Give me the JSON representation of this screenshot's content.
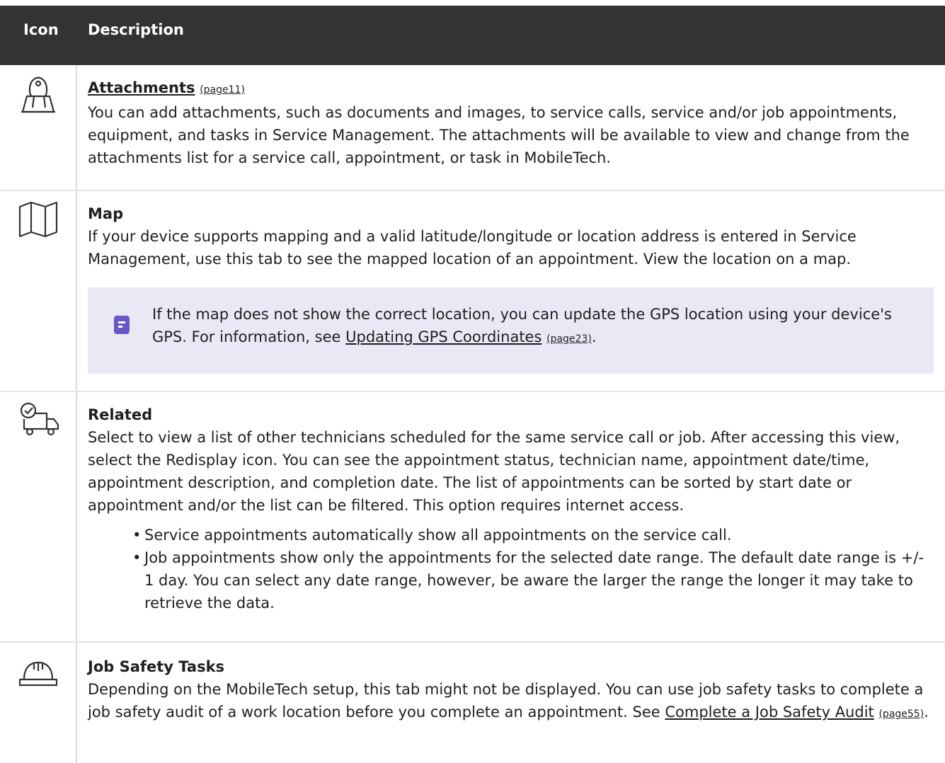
{
  "header": {
    "icon_col": "Icon",
    "desc_col": "Description"
  },
  "rows": {
    "attachments": {
      "icon": "binder-clip-icon",
      "title": "Attachments",
      "page_ref": "(page11)",
      "body": "You can add attachments, such as documents and images, to service calls, service and/or job appointments, equipment, and tasks in Service Management. The attachments will be available to view and change from the attachments list for a service call, appointment, or task in MobileTech."
    },
    "map": {
      "icon": "folded-map-icon",
      "title": "Map",
      "body": "If your device supports mapping and a valid latitude/longitude or location address is entered in Service Management, use this tab to see the mapped location of an appointment. View the location on a map.",
      "note": {
        "icon": "note-icon",
        "text": "If the map does not show the correct location, you can update the GPS location using your device's GPS. For information, see ",
        "link_text": "Updating GPS Coordinates",
        "page_ref": "(page23)",
        "suffix": "."
      }
    },
    "related": {
      "icon": "truck-check-icon",
      "title": "Related",
      "body": "Select to view a list of other technicians scheduled for the same service call or job. After accessing this view, select the Redisplay icon. You can see the appointment status, technician name, appointment date/time, appointment description, and completion date. The list of appointments can be sorted by start date or appointment and/or the list can be filtered. This option requires internet access.",
      "bullets": [
        "Service appointments automatically show all appointments on the service call.",
        "Job appointments show only the appointments for the selected date range. The default date range is +/- 1 day. You can select any date range, however, be aware the larger the range the longer it may take to retrieve the data."
      ]
    },
    "safety": {
      "icon": "hard-hat-icon",
      "title": "Job Safety Tasks",
      "body": "Depending on the MobileTech setup, this tab might not be displayed. You can use job safety tasks to complete a job safety audit of a work location before you complete an appointment. See ",
      "link_text": "Complete a Job Safety Audit",
      "page_ref": "(page55)",
      "suffix": "."
    }
  },
  "colors": {
    "header_bg": "#333333",
    "note_bg": "#e9e9f6",
    "note_icon": "#6b56c8"
  }
}
